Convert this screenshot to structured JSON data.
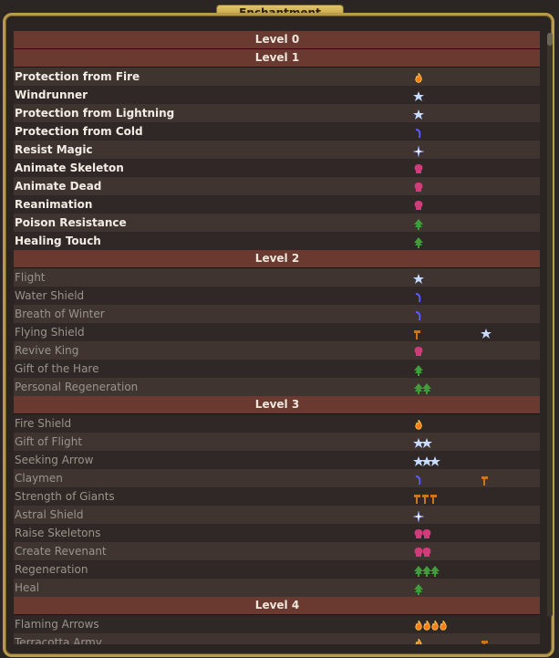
{
  "window": {
    "title": "Enchantment"
  },
  "colors": {
    "fire": "#ff7a1a",
    "air": "#c8dcff",
    "water": "#5a5aff",
    "arcane": "#ffffff",
    "death": "#d03c7a",
    "nature": "#3f9e3a",
    "earth": "#c9761f",
    "header": "#6a3a30"
  },
  "rows": [
    {
      "type": "header",
      "label": "Level 0"
    },
    {
      "type": "header",
      "label": "Level 1"
    },
    {
      "type": "spell",
      "name": "Protection from Fire",
      "known": true,
      "icons": [
        {
          "kind": "fire",
          "count": 1
        }
      ]
    },
    {
      "type": "spell",
      "name": "Windrunner",
      "known": true,
      "icons": [
        {
          "kind": "air",
          "count": 1
        }
      ]
    },
    {
      "type": "spell",
      "name": "Protection from Lightning",
      "known": true,
      "icons": [
        {
          "kind": "air",
          "count": 1
        }
      ]
    },
    {
      "type": "spell",
      "name": "Protection from Cold",
      "known": true,
      "icons": [
        {
          "kind": "water",
          "count": 1
        }
      ]
    },
    {
      "type": "spell",
      "name": "Resist Magic",
      "known": true,
      "icons": [
        {
          "kind": "arcane",
          "count": 1
        }
      ]
    },
    {
      "type": "spell",
      "name": "Animate Skeleton",
      "known": true,
      "icons": [
        {
          "kind": "death",
          "count": 1
        }
      ]
    },
    {
      "type": "spell",
      "name": "Animate Dead",
      "known": true,
      "icons": [
        {
          "kind": "death",
          "count": 1
        }
      ]
    },
    {
      "type": "spell",
      "name": "Reanimation",
      "known": true,
      "icons": [
        {
          "kind": "death",
          "count": 1
        }
      ]
    },
    {
      "type": "spell",
      "name": "Poison Resistance",
      "known": true,
      "icons": [
        {
          "kind": "nature",
          "count": 1
        }
      ]
    },
    {
      "type": "spell",
      "name": "Healing Touch",
      "known": true,
      "icons": [
        {
          "kind": "nature",
          "count": 1
        }
      ]
    },
    {
      "type": "header",
      "label": "Level 2"
    },
    {
      "type": "spell",
      "name": "Flight",
      "known": false,
      "icons": [
        {
          "kind": "air",
          "count": 1
        }
      ]
    },
    {
      "type": "spell",
      "name": "Water Shield",
      "known": false,
      "icons": [
        {
          "kind": "water",
          "count": 1
        }
      ]
    },
    {
      "type": "spell",
      "name": "Breath of Winter",
      "known": false,
      "icons": [
        {
          "kind": "water",
          "count": 1
        }
      ]
    },
    {
      "type": "spell",
      "name": "Flying Shield",
      "known": false,
      "icons": [
        {
          "kind": "earth",
          "count": 1
        }
      ],
      "icons2": [
        {
          "kind": "air",
          "count": 1
        }
      ]
    },
    {
      "type": "spell",
      "name": "Revive King",
      "known": false,
      "icons": [
        {
          "kind": "death",
          "count": 1
        }
      ]
    },
    {
      "type": "spell",
      "name": "Gift of the Hare",
      "known": false,
      "icons": [
        {
          "kind": "nature",
          "count": 1
        }
      ]
    },
    {
      "type": "spell",
      "name": "Personal Regeneration",
      "known": false,
      "icons": [
        {
          "kind": "nature",
          "count": 2
        }
      ]
    },
    {
      "type": "header",
      "label": "Level 3"
    },
    {
      "type": "spell",
      "name": "Fire Shield",
      "known": false,
      "icons": [
        {
          "kind": "fire",
          "count": 1
        }
      ]
    },
    {
      "type": "spell",
      "name": "Gift of Flight",
      "known": false,
      "icons": [
        {
          "kind": "air",
          "count": 2
        }
      ]
    },
    {
      "type": "spell",
      "name": "Seeking Arrow",
      "known": false,
      "icons": [
        {
          "kind": "air",
          "count": 3
        }
      ]
    },
    {
      "type": "spell",
      "name": "Claymen",
      "known": false,
      "icons": [
        {
          "kind": "water",
          "count": 1
        }
      ],
      "icons2": [
        {
          "kind": "earth",
          "count": 1
        }
      ]
    },
    {
      "type": "spell",
      "name": "Strength of Giants",
      "known": false,
      "icons": [
        {
          "kind": "earth",
          "count": 3
        }
      ]
    },
    {
      "type": "spell",
      "name": "Astral Shield",
      "known": false,
      "icons": [
        {
          "kind": "arcane",
          "count": 1
        }
      ]
    },
    {
      "type": "spell",
      "name": "Raise Skeletons",
      "known": false,
      "icons": [
        {
          "kind": "death",
          "count": 2
        }
      ]
    },
    {
      "type": "spell",
      "name": "Create Revenant",
      "known": false,
      "icons": [
        {
          "kind": "death",
          "count": 2
        }
      ]
    },
    {
      "type": "spell",
      "name": "Regeneration",
      "known": false,
      "icons": [
        {
          "kind": "nature",
          "count": 3
        }
      ]
    },
    {
      "type": "spell",
      "name": "Heal",
      "known": false,
      "icons": [
        {
          "kind": "nature",
          "count": 1
        }
      ]
    },
    {
      "type": "header",
      "label": "Level 4"
    },
    {
      "type": "spell",
      "name": "Flaming Arrows",
      "known": false,
      "icons": [
        {
          "kind": "fire",
          "count": 4
        }
      ]
    },
    {
      "type": "spell",
      "name": "Terracotta Army",
      "known": false,
      "icons": [
        {
          "kind": "fire",
          "count": 1
        }
      ],
      "icons2": [
        {
          "kind": "earth",
          "count": 1
        }
      ]
    }
  ]
}
